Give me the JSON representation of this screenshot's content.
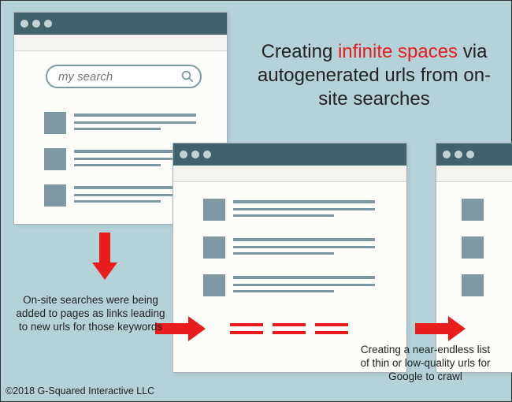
{
  "headline": {
    "pre": "Creating ",
    "highlight": "infinite spaces",
    "post": " via autogenerated urls from on-site searches"
  },
  "search": {
    "placeholder": "my search"
  },
  "captions": {
    "caption1": "On-site searches were being added to pages as links leading to new urls for those keywords",
    "caption2": "Creating a near-endless list of thin or low-quality urls for Google to crawl"
  },
  "copyright": "©2018 G-Squared Interactive LLC"
}
